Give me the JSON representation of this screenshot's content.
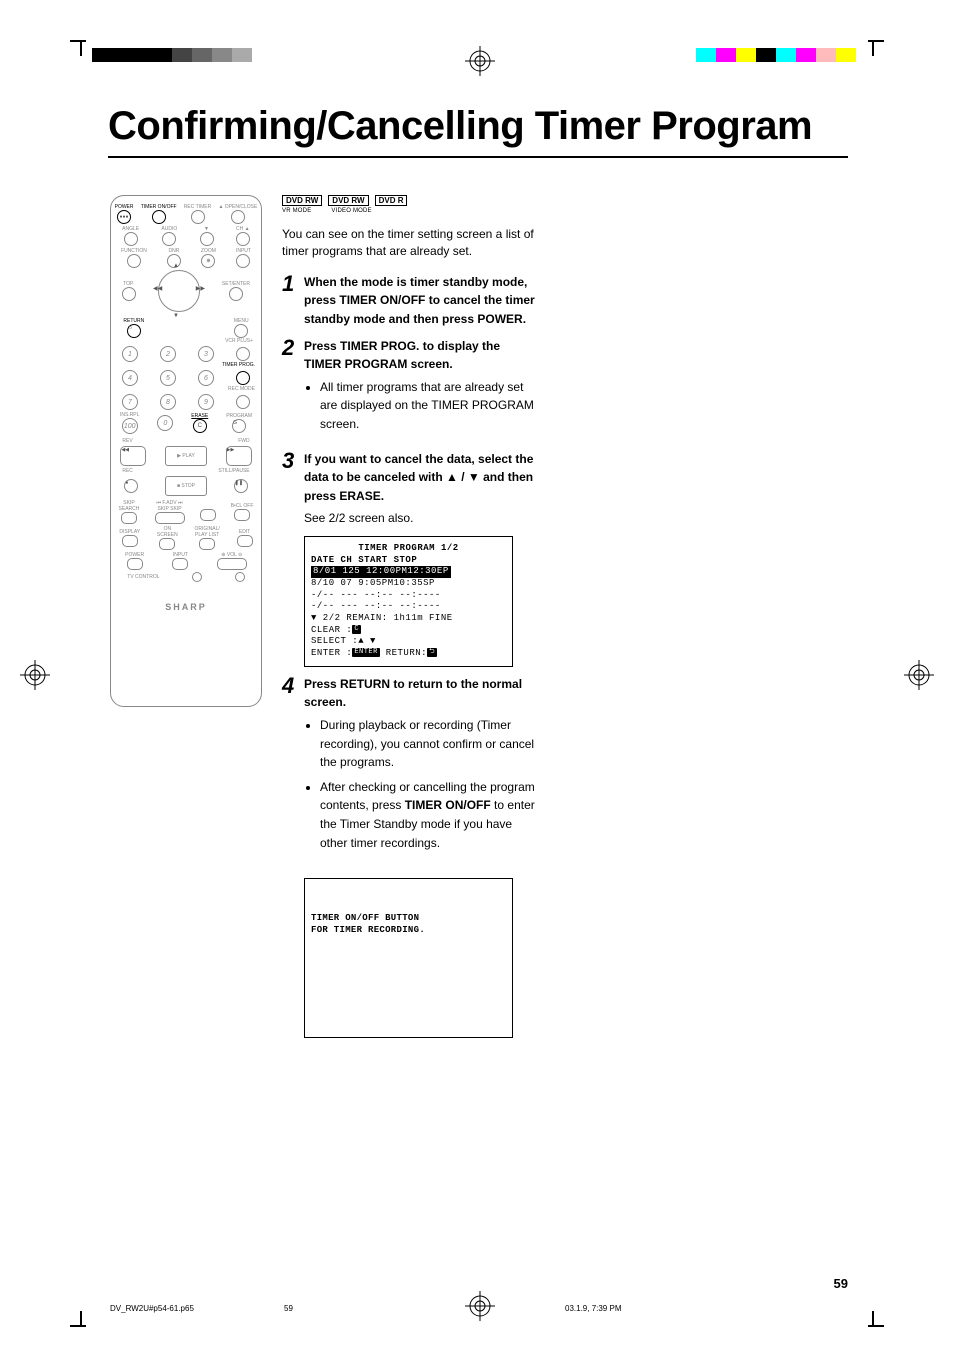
{
  "heading": "Confirming/Cancelling Timer Program",
  "tags": {
    "tag1": "DVD RW",
    "tag2": "DVD RW",
    "tag3": "DVD R",
    "sub1": "VR MODE",
    "sub2": "VIDEO MODE"
  },
  "intro": "You can see on the timer setting screen a list of timer programs that are already set.",
  "steps": {
    "s1": {
      "num": "1",
      "pre": "When the mode is timer standby mode, press ",
      "bold1": "TIMER ON/OFF",
      "mid": " to cancel the timer standby mode and then press ",
      "bold2": "POWER",
      "post": "."
    },
    "s2": {
      "num": "2",
      "pre": "Press ",
      "bold1": "TIMER PROG.",
      "mid": " to display the TIMER PROGRAM screen.",
      "bullet": "All timer programs that are already set are displayed on the TIMER PROGRAM screen."
    },
    "s3": {
      "num": "3",
      "pre": "If you want to cancel the data, select the data to be canceled with ",
      "arrows": "▲ / ▼",
      "mid": " and then press ",
      "bold1": "ERASE",
      "post": ".",
      "see": "See 2/2 screen also."
    },
    "s4": {
      "num": "4",
      "pre": "Press ",
      "bold1": "RETURN",
      "mid": " to return to the normal screen.",
      "b1": "During playback or recording (Timer recording), you cannot confirm or cancel the programs.",
      "b2a": "After checking or cancelling the program contents, press ",
      "b2bold": "TIMER ON/OFF",
      "b2b": " to enter the Timer Standby mode if you have other timer recordings."
    }
  },
  "screen1": {
    "title": "TIMER PROGRAM  1/2",
    "header": "DATE  CH  START STOP",
    "r1": "8/01 125  12:00PM12:30EP",
    "r2": " 8/10  07   9:05PM10:35SP",
    "r3": " -/--  ---  --:-- --:----",
    "r4": " -/--  ---  --:-- --:----",
    "footer": "▼ 2/2 REMAIN: 1h11m FINE",
    "clear": "CLEAR  :",
    "clear_key": "C",
    "select": "SELECT :▲ ▼",
    "enter": "ENTER  :",
    "enter_key": "ENTER",
    "returnl": "  RETURN:",
    "return_icon": "⮌"
  },
  "screen2": {
    "l1": "TIMER ON/OFF BUTTON",
    "l2": "FOR TIMER RECORDING."
  },
  "remote": {
    "power": "POWER",
    "timer": "TIMER ON/OFF",
    "return": "RETURN",
    "erase": "ERASE",
    "timerprog": "TIMER PROG.",
    "play": "▶ PLAY",
    "stop": "■ STOP",
    "logo": "SHARP"
  },
  "footer": {
    "file": "DV_RW2U#p54-61.p65",
    "page": "59",
    "date": "03.1.9, 7:39 PM"
  },
  "page_num": "59"
}
